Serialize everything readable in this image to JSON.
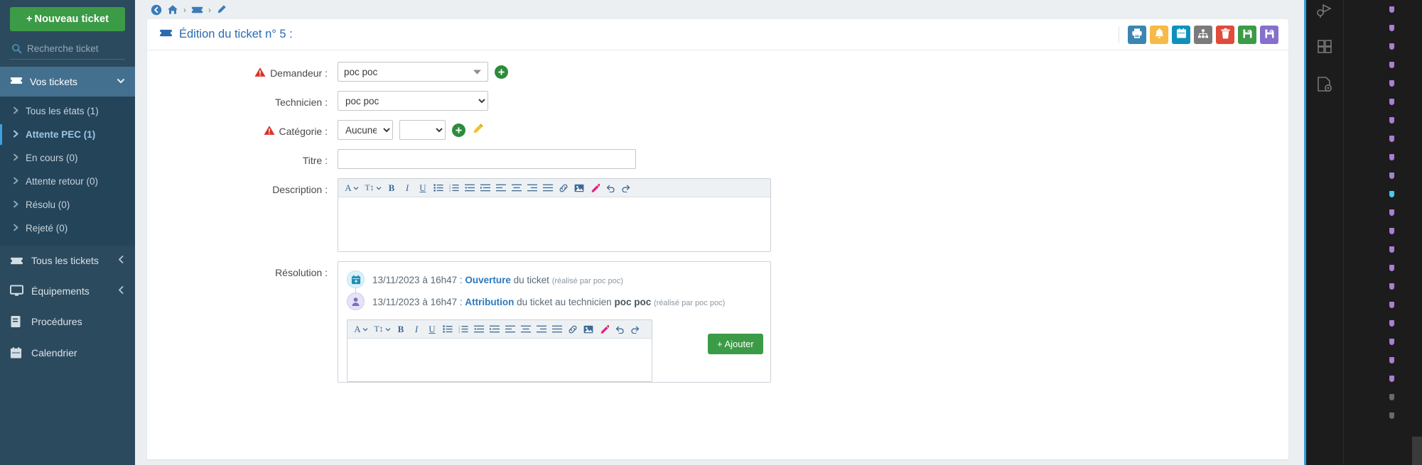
{
  "sidebar": {
    "new_ticket_label": "Nouveau ticket",
    "new_ticket_plus": "+",
    "search_placeholder": "Recherche ticket",
    "group": {
      "label": "Vos tickets"
    },
    "sub_items": [
      {
        "label": "Tous les états (1)",
        "active": false
      },
      {
        "label": "Attente PEC (1)",
        "active": true
      },
      {
        "label": "En cours (0)",
        "active": false
      },
      {
        "label": "Attente retour (0)",
        "active": false
      },
      {
        "label": "Résolu (0)",
        "active": false
      },
      {
        "label": "Rejeté (0)",
        "active": false
      }
    ],
    "nav_items": [
      {
        "label": "Tous les tickets",
        "icon": "ticket-icon",
        "chevron": true
      },
      {
        "label": "Équipements",
        "icon": "monitor-icon",
        "chevron": true
      },
      {
        "label": "Procédures",
        "icon": "book-icon",
        "chevron": false
      },
      {
        "label": "Calendrier",
        "icon": "calendar-icon",
        "chevron": false
      }
    ]
  },
  "breadcrumb": {
    "items": [
      "back-circle-icon",
      "home-icon",
      "ticket-icon",
      "pencil-icon"
    ],
    "separator": "›"
  },
  "card": {
    "title": "Édition du ticket n° 5 :",
    "actions": [
      {
        "name": "print-button",
        "icon": "printer-icon",
        "color": "#3b86b0"
      },
      {
        "name": "notify-button",
        "icon": "bell-icon",
        "color": "#f7b948"
      },
      {
        "name": "calendar-button",
        "icon": "calendar-icon",
        "color": "#0e92bb"
      },
      {
        "name": "hierarchy-button",
        "icon": "sitemap-icon",
        "color": "#7b7b7b"
      },
      {
        "name": "delete-button",
        "icon": "trash-icon",
        "color": "#e04b3c"
      },
      {
        "name": "save-button",
        "icon": "floppy-icon",
        "color": "#3c9b46"
      },
      {
        "name": "save-close-button",
        "icon": "floppy-icon",
        "color": "#8570cd"
      }
    ]
  },
  "form": {
    "demandeur": {
      "label": "Demandeur :",
      "value": "poc poc",
      "required": true,
      "add_label": "+"
    },
    "technicien": {
      "label": "Technicien :",
      "value": "poc poc",
      "required": false
    },
    "categorie": {
      "label": "Catégorie :",
      "required": true,
      "value1": "Aucune",
      "value2": "",
      "add_label": "+",
      "edit_icon": "pencil-icon"
    },
    "titre": {
      "label": "Titre :",
      "value": "",
      "placeholder": ""
    },
    "description": {
      "label": "Description :",
      "value": ""
    },
    "resolution": {
      "label": "Résolution :"
    }
  },
  "editor_toolbar": [
    {
      "name": "font-family-button",
      "glyph": "A",
      "caret": true
    },
    {
      "name": "font-size-button",
      "glyph": "T↕",
      "caret": true
    },
    {
      "name": "bold-button",
      "glyph": "B",
      "caret": false
    },
    {
      "name": "italic-button",
      "glyph": "I",
      "caret": false
    },
    {
      "name": "underline-button",
      "glyph": "U",
      "caret": false
    },
    {
      "name": "bullet-list-button",
      "glyph": "☰",
      "caret": false
    },
    {
      "name": "numbered-list-button",
      "glyph": "☰",
      "caret": false
    },
    {
      "name": "outdent-button",
      "glyph": "☰",
      "caret": false
    },
    {
      "name": "indent-button",
      "glyph": "☰",
      "caret": false
    },
    {
      "name": "align-left-button",
      "glyph": "☰",
      "caret": false
    },
    {
      "name": "align-center-button",
      "glyph": "☰",
      "caret": false
    },
    {
      "name": "align-right-button",
      "glyph": "☰",
      "caret": false
    },
    {
      "name": "align-justify-button",
      "glyph": "☰",
      "caret": false
    },
    {
      "name": "link-button",
      "glyph": "🔗",
      "caret": false
    },
    {
      "name": "image-button",
      "glyph": "▣",
      "caret": false
    },
    {
      "name": "color-picker-button",
      "glyph": "✒",
      "caret": false
    },
    {
      "name": "undo-button",
      "glyph": "↺",
      "caret": false
    },
    {
      "name": "redo-button",
      "glyph": "↻",
      "caret": false
    }
  ],
  "timeline": [
    {
      "icon": "calendar-plus-icon",
      "datetime": "13/11/2023 à 16h47 : ",
      "keyword": "Ouverture",
      "rest": " du ticket ",
      "tech": "",
      "meta": "(réalisé par poc poc)"
    },
    {
      "icon": "user-icon",
      "datetime": "13/11/2023 à 16h47 : ",
      "keyword": "Attribution",
      "rest": " du ticket au technicien ",
      "tech": "poc poc",
      "meta": "(réalisé par poc poc)"
    }
  ],
  "resolution_actions": {
    "add_label": "Ajouter",
    "add_plus": "+"
  },
  "colors": {
    "sidebar_bg": "#2c4a5e",
    "sidebar_sub_bg": "#24445a",
    "sidebar_active": "#44708f",
    "accent_blue": "#2a6bb0",
    "green": "#3c9b46",
    "page_bg": "#eceff2"
  }
}
